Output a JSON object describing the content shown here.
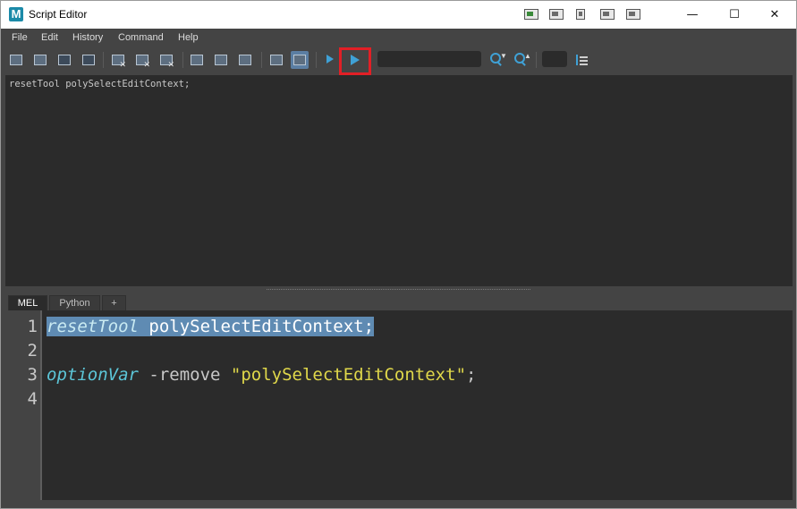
{
  "window": {
    "app_icon_letter": "M",
    "title": "Script Editor",
    "controls": {
      "minimize": "—",
      "maximize": "☐",
      "close": "✕"
    }
  },
  "menu": [
    "File",
    "Edit",
    "History",
    "Command",
    "Help"
  ],
  "toolbar": {
    "tools": [
      "open-script-icon",
      "source-script-icon",
      "save-script-icon",
      "save-script-to-shelf-icon",
      "clear-history-icon",
      "clear-input-icon",
      "clear-all-icon",
      "show-history-only-icon",
      "show-input-only-icon",
      "show-both-icon",
      "echo-all-commands-icon",
      "show-line-numbers-icon",
      "execute-all-icon",
      "execute-icon",
      "search-down-icon",
      "search-up-icon",
      "goto-line-icon"
    ],
    "accent_color": "#3fa1d6",
    "highlight_color": "#e21f26"
  },
  "history": {
    "lines": [
      "resetTool polySelectEditContext;"
    ]
  },
  "tabs": [
    "MEL",
    "Python",
    "+"
  ],
  "editor": {
    "line_numbers": [
      "1",
      "2",
      "3",
      "4"
    ],
    "line1": {
      "cmd": "resetTool",
      "rest": " polySelectEditContext;"
    },
    "line3": {
      "cmd": "optionVar",
      "flag": " -remove ",
      "string": "\"polySelectEditContext\"",
      "end": ";"
    }
  }
}
